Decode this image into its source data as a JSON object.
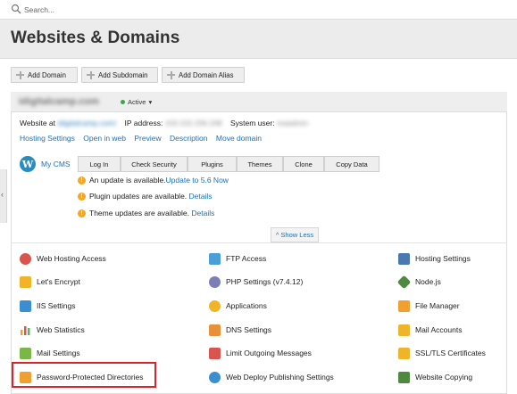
{
  "search": {
    "placeholder": "Search..."
  },
  "page": {
    "title": "Websites & Domains"
  },
  "gutter_glyph": "‹",
  "toolbar": {
    "add_domain": "Add Domain",
    "add_subdomain": "Add Subdomain",
    "add_domain_alias": "Add Domain Alias"
  },
  "domain": {
    "name": "idigitalcamp.com",
    "status": "Active",
    "status_caret": "▾",
    "website_at_label": "Website at",
    "website_at_value": "idigitalcamp.com/",
    "ip_label": "IP address:",
    "ip_value": "103.102.236.248",
    "sysuser_label": "System user:",
    "sysuser_value": "maadmin",
    "links": [
      "Hosting Settings",
      "Open in web",
      "Preview",
      "Description",
      "Move domain"
    ]
  },
  "wordpress": {
    "icon_letter": "W",
    "name": "My CMS",
    "buttons": [
      "Log In",
      "Check Security",
      "Plugins",
      "Themes",
      "Clone",
      "Copy Data"
    ],
    "notice_icon": "!",
    "notices": [
      {
        "text": "An update is available.",
        "link": "Update to 5.6 Now"
      },
      {
        "text": "Plugin updates are available.",
        "link": "Details"
      },
      {
        "text": "Theme updates are available.",
        "link": "Details"
      }
    ]
  },
  "show_less": {
    "glyph": "^",
    "label": "Show Less"
  },
  "tools": {
    "col1": [
      "Web Hosting Access",
      "Let's Encrypt",
      "IIS Settings",
      "Web Statistics",
      "Mail Settings",
      "Password-Protected Directories"
    ],
    "col2": [
      "FTP Access",
      "PHP Settings (v7.4.12)",
      "Applications",
      "DNS Settings",
      "Limit Outgoing Messages",
      "Web Deploy Publishing Settings"
    ],
    "col3": [
      "Hosting Settings",
      "Node.js",
      "File Manager",
      "Mail Accounts",
      "SSL/TLS Certificates",
      "Website Copying"
    ]
  },
  "colors": {
    "link": "#1f6fb2",
    "active_dot": "#3aa74a",
    "warning": "#f5a623",
    "highlight_border": "#d9232d"
  }
}
